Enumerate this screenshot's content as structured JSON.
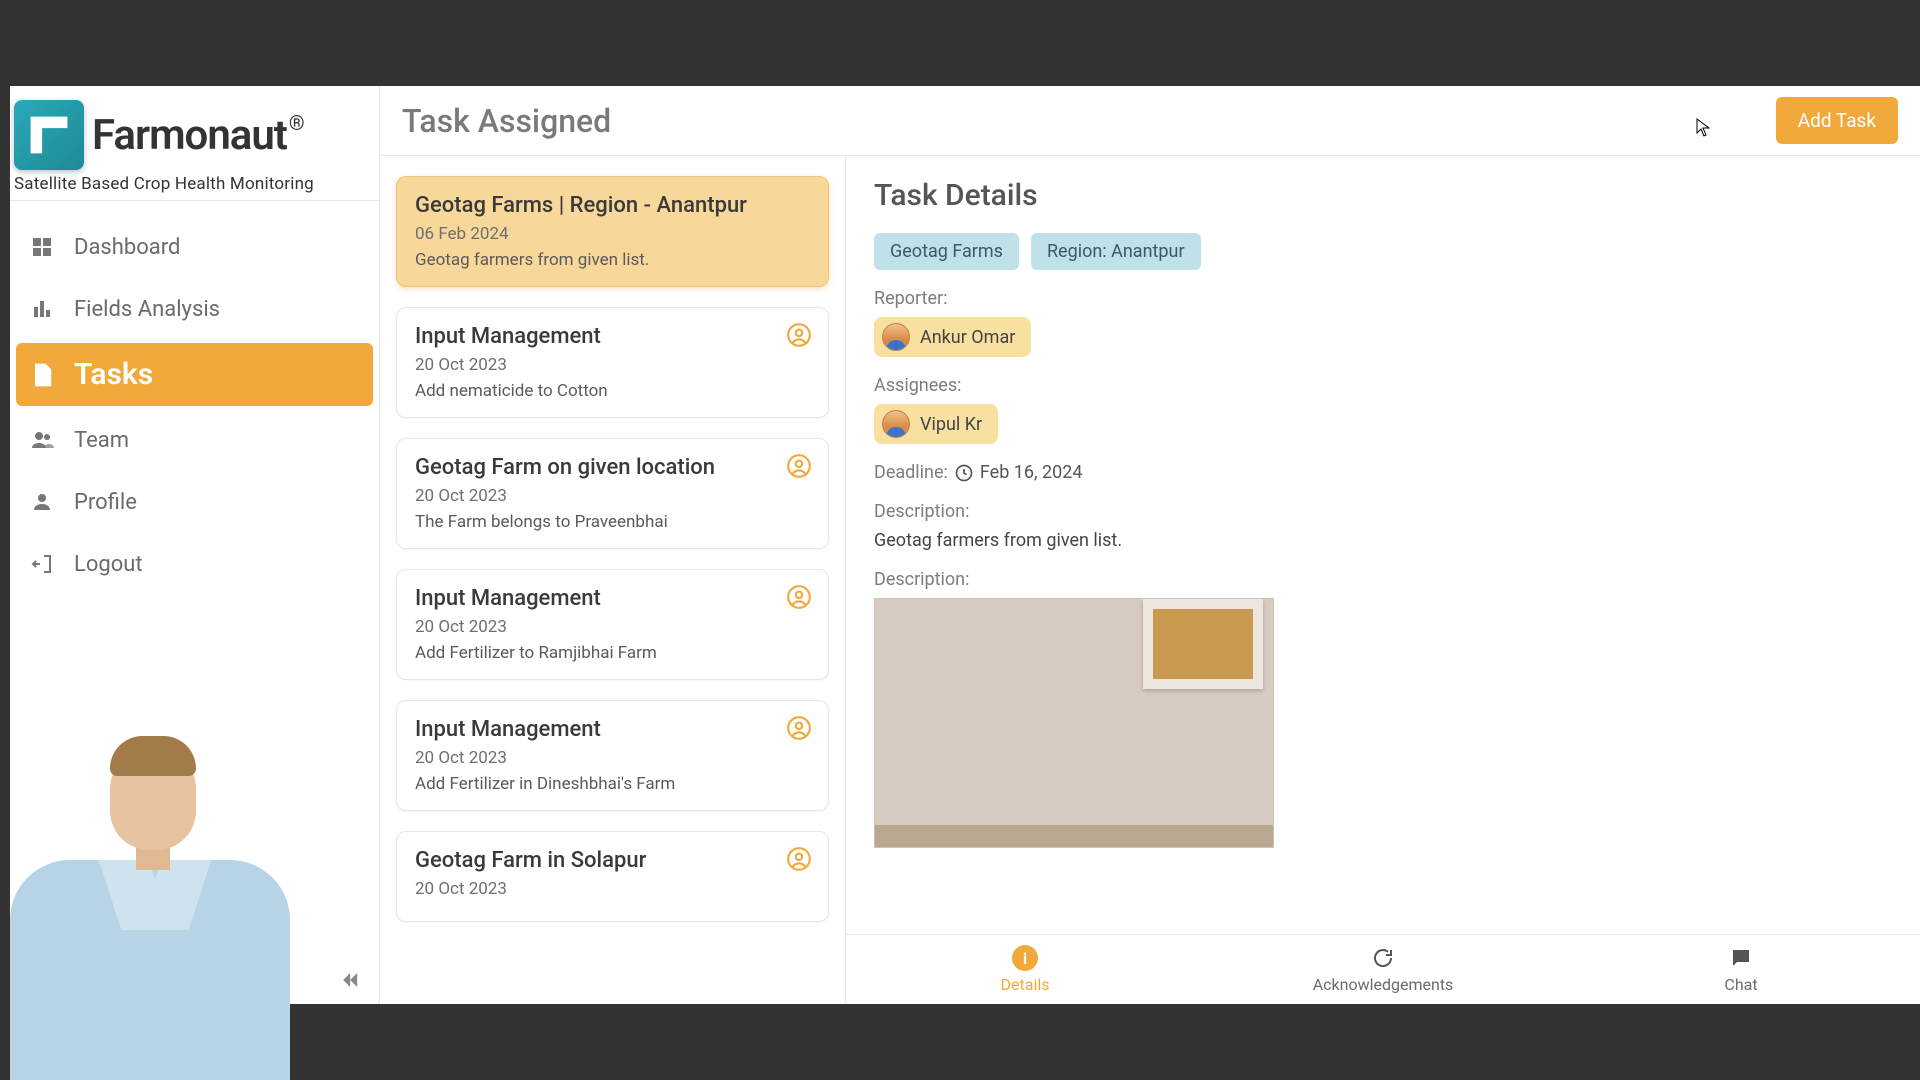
{
  "brand": {
    "name": "Farmonaut",
    "reg": "®",
    "tagline": "Satellite Based Crop Health Monitoring"
  },
  "nav": {
    "dashboard": "Dashboard",
    "fields": "Fields Analysis",
    "tasks": "Tasks",
    "team": "Team",
    "profile": "Profile",
    "logout": "Logout"
  },
  "header": {
    "title": "Task Assigned",
    "add_task": "Add Task"
  },
  "tasks": [
    {
      "title": "Geotag Farms | Region - Anantpur",
      "date": "06 Feb 2024",
      "desc": "Geotag farmers from given list.",
      "active": true,
      "user_icon": false
    },
    {
      "title": "Input Management",
      "date": "20 Oct 2023",
      "desc": "Add nematicide to Cotton",
      "active": false,
      "user_icon": true
    },
    {
      "title": "Geotag Farm on given location",
      "date": "20 Oct 2023",
      "desc": "The Farm belongs to Praveenbhai",
      "active": false,
      "user_icon": true
    },
    {
      "title": "Input Management",
      "date": "20 Oct 2023",
      "desc": "Add Fertilizer to Ramjibhai Farm",
      "active": false,
      "user_icon": true
    },
    {
      "title": "Input Management",
      "date": "20 Oct 2023",
      "desc": "Add Fertilizer in Dineshbhai's Farm",
      "active": false,
      "user_icon": true
    },
    {
      "title": "Geotag Farm in Solapur",
      "date": "20 Oct 2023",
      "desc": "",
      "active": false,
      "user_icon": true
    }
  ],
  "detail": {
    "heading": "Task Details",
    "chips": [
      "Geotag Farms",
      "Region: Anantpur"
    ],
    "reporter_label": "Reporter:",
    "reporter": "Ankur Omar",
    "assignees_label": "Assignees:",
    "assignee": "Vipul Kr",
    "deadline_label": "Deadline:",
    "deadline": "Feb 16, 2024",
    "description_label": "Description:",
    "description": "Geotag farmers from given list.",
    "attachment_label": "Description:"
  },
  "tabs": {
    "details": "Details",
    "ack": "Acknowledgements",
    "chat": "Chat"
  }
}
